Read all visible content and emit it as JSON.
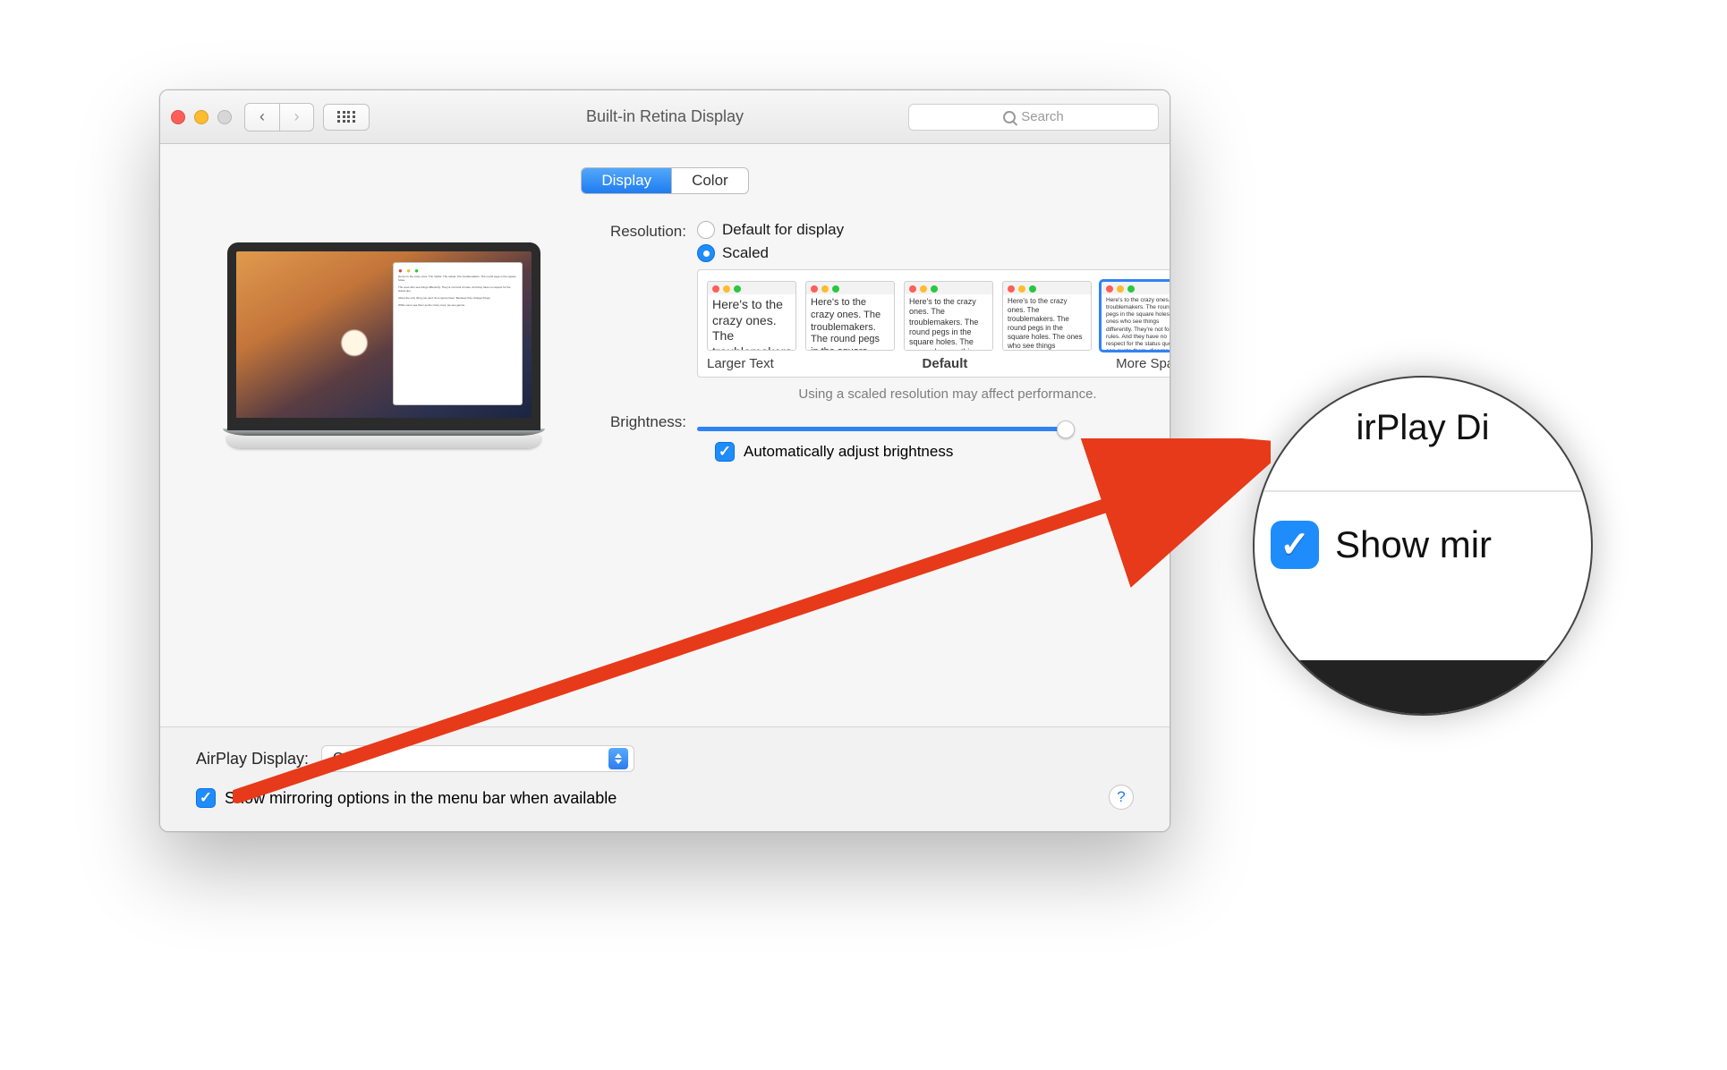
{
  "colors": {
    "accent": "#1f8cfb"
  },
  "titlebar": {
    "title": "Built-in Retina Display",
    "search_placeholder": "Search"
  },
  "tabs": {
    "display": "Display",
    "color": "Color",
    "active": "display"
  },
  "resolution": {
    "label": "Resolution:",
    "option_default": "Default for display",
    "option_scaled": "Scaled",
    "selected": "scaled",
    "thumbs_sample": "Here's to the crazy ones. The troublemakers. The round pegs in the square holes. The ones who see things differently. They're not fond of rules. And they have no respect for the status quo. You can quote them, disagree with them. About the only thing you can't do is ignore them. Because they change things.",
    "thumbs_caption_left": "Larger Text",
    "thumbs_caption_center": "Default",
    "thumbs_caption_right": "More Space",
    "perf_note": "Using a scaled resolution may affect performance."
  },
  "brightness": {
    "label": "Brightness:",
    "value_pct": 98,
    "auto_label": "Automatically adjust brightness",
    "auto_checked": true
  },
  "footer": {
    "airplay_label": "AirPlay Display:",
    "airplay_value": "Off",
    "mirror_label": "Show mirroring options in the menu bar when available",
    "mirror_checked": true,
    "help": "?"
  },
  "zoom": {
    "top_text": "irPlay Di",
    "label": "Show mir"
  }
}
